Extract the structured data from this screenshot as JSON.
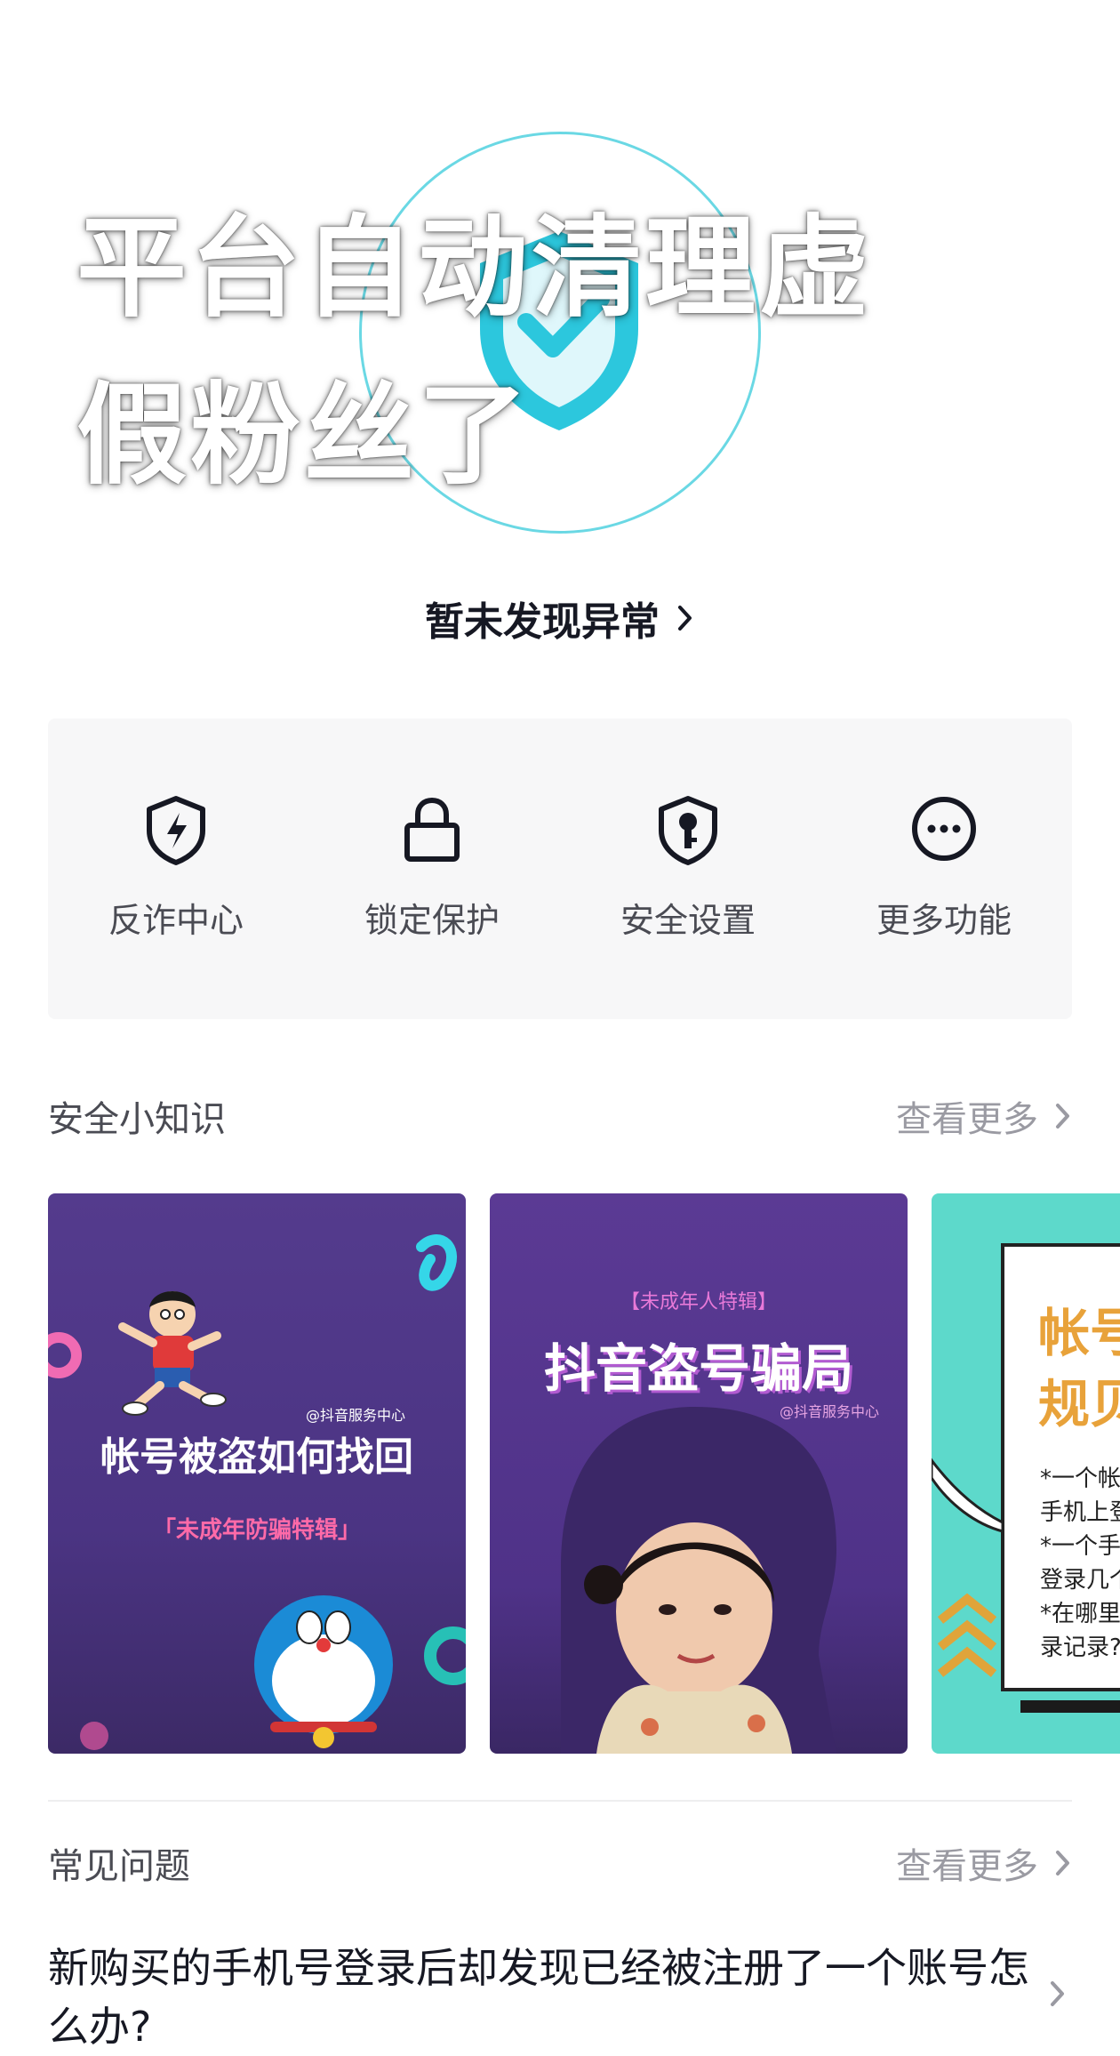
{
  "overlay": {
    "line1": "平台自动清理虚",
    "line2": "假粉丝了"
  },
  "status": {
    "text": "暂未发现异常",
    "ring_color": "#6ad8e4",
    "shield_color": "#2cc7dd"
  },
  "quick_actions": [
    {
      "label": "反诈中心",
      "icon": "lightning-shield-icon"
    },
    {
      "label": "锁定保护",
      "icon": "lock-icon"
    },
    {
      "label": "安全设置",
      "icon": "key-shield-icon"
    },
    {
      "label": "更多功能",
      "icon": "more-dots-icon"
    }
  ],
  "knowledge": {
    "title": "安全小知识",
    "more": "查看更多",
    "cards": [
      {
        "source": "@抖音服务中心",
        "title": "帐号被盗如何找回",
        "subtitle": "「未成年防骗特辑」"
      },
      {
        "tag": "【未成年人特辑】",
        "title": "抖音盗号骗局",
        "source": "@抖音服务中心"
      },
      {
        "title_partial_1": "帐号",
        "title_partial_2": "规贝",
        "lines": [
          "*一个帐",
          "手机上登",
          "*一个手",
          "登录几个",
          "*在哪里",
          "录记录?"
        ]
      }
    ]
  },
  "faq": {
    "title": "常见问题",
    "more": "查看更多",
    "question": "新购买的手机号登录后却发现已经被注册了一个账号怎么办?"
  }
}
